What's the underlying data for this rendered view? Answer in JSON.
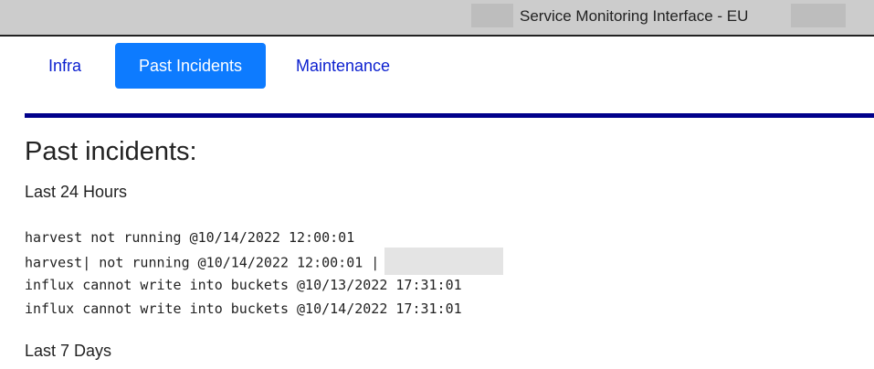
{
  "header": {
    "title": "Service Monitoring Interface - EU"
  },
  "tabs": [
    {
      "label": "Infra",
      "active": false
    },
    {
      "label": "Past Incidents",
      "active": true
    },
    {
      "label": "Maintenance",
      "active": false
    }
  ],
  "colors": {
    "active_tab_bg": "#0d7bff",
    "tab_link": "#0b1fcf",
    "divider": "#00008b",
    "topbar_bg": "#cccccc"
  },
  "main": {
    "heading": "Past incidents:",
    "sections": [
      {
        "label": "Last 24 Hours",
        "incidents": [
          "harvest not running @10/14/2022 12:00:01",
          "harvest| not running @10/14/2022 12:00:01 |",
          "influx cannot write into buckets @10/13/2022 17:31:01",
          "influx cannot write into buckets @10/14/2022 17:31:01"
        ]
      },
      {
        "label": "Last 7 Days",
        "incidents": []
      }
    ]
  }
}
